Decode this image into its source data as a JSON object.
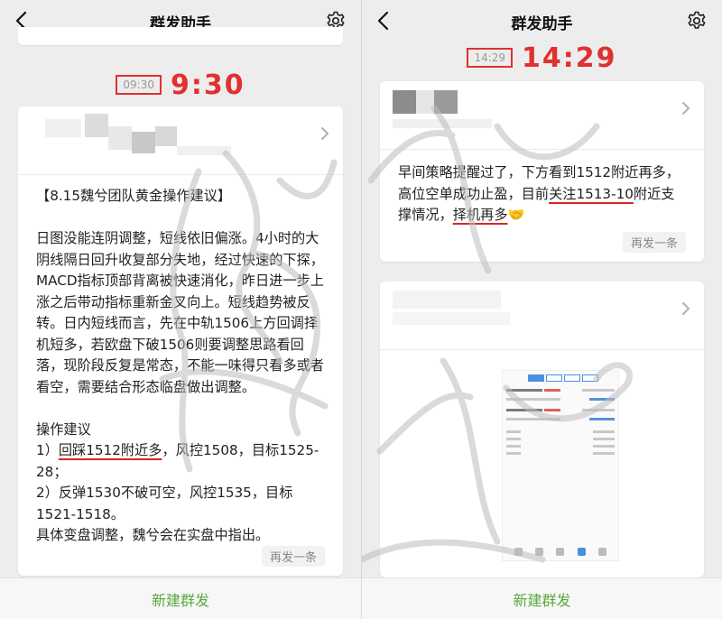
{
  "left": {
    "nav": {
      "title": "群发助手"
    },
    "timestamp": {
      "small": "09:30",
      "big": "9:30"
    },
    "message": {
      "heading": "【8.15魏兮团队黄金操作建议】",
      "analysis": "日图没能连阴调整，短线依旧偏涨。4小时的大阴线隔日回升收复部分失地，经过快速的下探，MACD指标顶部背离被快速消化，昨日进一步上涨之后带动指标重新金叉向上。短线趋势被反转。日内短线而言，先在中轨1506上方回调择机短多，若欧盘下破1506则要调整思路看回落，现阶段反复是常态，不能一味得只看多或者看空，需要结合形态临盘做出调整。",
      "ops_title": "操作建议",
      "op1_prefix": "1）",
      "op1_highlight": "回踩1512附近多",
      "op1_rest": "，风控1508，目标1525-28；",
      "op2": "2）反弹1530不破可空，风控1535，目标1521-1518。",
      "closing": "具体变盘调整，魏兮会在实盘中指出。"
    },
    "resend_label": "再发一条",
    "bottom_label": "新建群发"
  },
  "right": {
    "nav": {
      "title": "群发助手"
    },
    "timestamp": {
      "small": "14:29",
      "big": "14:29"
    },
    "message": {
      "part1": "早间策略提醒过了，下方看到1512附近再多，高位空单成功止盈，目前",
      "highlight1": "关注1513-10",
      "part2": "附近支撑情况，",
      "highlight2": "择机再多",
      "emoji": "🤝"
    },
    "resend_label": "再发一条",
    "bottom_label": "新建群发",
    "screenshot_lines": {
      "row1_label": "XAUUSD, sell 4.00",
      "row1_price": "1522.84 → 1518.25",
      "row1_profit": "1 836.00",
      "row2_label": "XAUUSD, sell 4.00",
      "row2_price": "1522.84 → 1515.59",
      "row2_profit": "2 816.00"
    }
  },
  "colors": {
    "accent_red": "#e03030",
    "wechat_green": "#5aa83f",
    "background": "#ededed"
  },
  "icons": [
    "back-chevron-icon",
    "settings-gear-icon",
    "card-chevron-icon",
    "handshake-emoji"
  ]
}
